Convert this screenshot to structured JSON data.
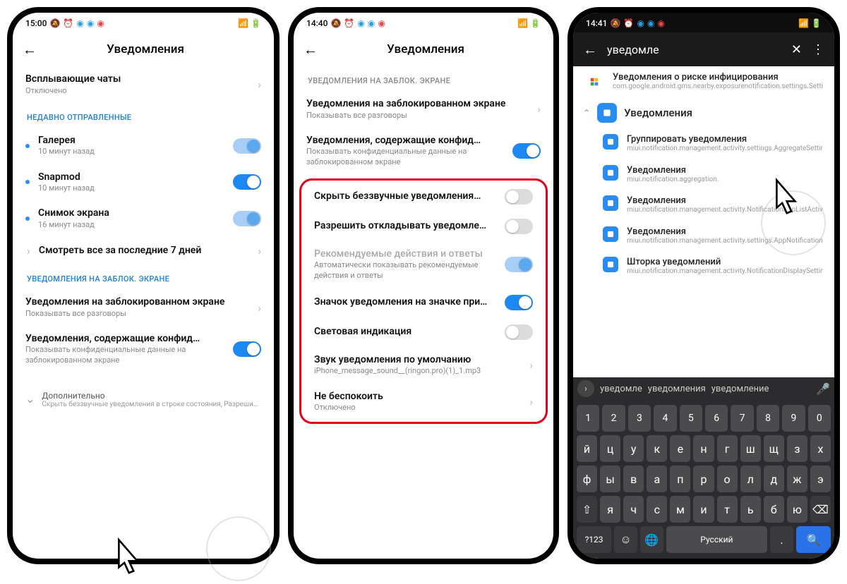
{
  "phone1": {
    "status": {
      "time": "15:00"
    },
    "title": "Уведомления",
    "popup": {
      "title": "Всплывающие чаты",
      "sub": "Отключено"
    },
    "recent_header": "НЕДАВНО ОТПРАВЛЕННЫЕ",
    "recent": [
      {
        "name": "Галерея",
        "sub": "10 минут назад",
        "toggle": "half"
      },
      {
        "name": "Snapmod",
        "sub": "10 минут назад",
        "toggle": "on"
      },
      {
        "name": "Снимок экрана",
        "sub": "16 минут назад",
        "toggle": "half"
      }
    ],
    "see_all": "Смотреть все за последние 7 дней",
    "lock_header": "УВЕДОМЛЕНИЯ НА ЗАБЛОК. ЭКРАНЕ",
    "lock1": {
      "title": "Уведомления на заблокированном экране",
      "sub": "Показывать все разговоры"
    },
    "lock2": {
      "title": "Уведомления, содержащие конфид…",
      "sub": "Показывать конфиденциальные данные на заблокированном экране"
    },
    "adv": {
      "title": "Дополнительно",
      "sub": "Скрыть беззвучные уведомления в строке состояния, Разрешить…"
    }
  },
  "phone2": {
    "status": {
      "time": "14:40"
    },
    "title": "Уведомления",
    "lock_header": "УВЕДОМЛЕНИЯ НА ЗАБЛОК. ЭКРАНЕ",
    "lock1": {
      "title": "Уведомления на заблокированном экране",
      "sub": "Показывать все разговоры"
    },
    "lock2": {
      "title": "Уведомления, содержащие конфид…",
      "sub": "Показывать конфиденциальные данные на заблокированном экране"
    },
    "items": [
      {
        "title": "Скрыть беззвучные уведомления…",
        "toggle": "off"
      },
      {
        "title": "Разрешить откладывать уведомле…",
        "toggle": "off"
      },
      {
        "title": "Рекомендуемые действия и ответы",
        "sub": "Автоматически показывать рекомендуемые действия и ответы",
        "toggle": "half",
        "disabled": true
      },
      {
        "title": "Значок уведомления на значке при…",
        "toggle": "on"
      },
      {
        "title": "Световая индикация",
        "toggle": "off"
      },
      {
        "title": "Звук уведомления по умолчанию",
        "sub": "iPhone_message_sound__(ringon.pro)(1)_1.mp3",
        "chev": true
      },
      {
        "title": "Не беспокоить",
        "sub": "Отключено",
        "chev": true
      }
    ]
  },
  "phone3": {
    "status": {
      "time": "14:41"
    },
    "search": "уведомле",
    "risk": {
      "title": "Уведомления о риске инфицирования",
      "sub": "com.google.android.gms.nearby.exposurenotification.settings.SettingsActivityAlias"
    },
    "parent": "Уведомления",
    "results": [
      {
        "title": "Группировать уведомления",
        "sub": "miui.notification.management.activity.settings.AggregateSettingActivity"
      },
      {
        "title": "Уведомления",
        "sub": "miui.notification.aggregation."
      },
      {
        "title": "Уведомления",
        "sub": "miui.notification.management.activity.NotificationAppListActivity"
      },
      {
        "title": "Уведомления",
        "sub": "miui.notification.management.activity.settings.AppNotificationRuleActivity"
      },
      {
        "title": "Шторка уведомлений",
        "sub": "miui.notification.management.activity.NotificationDisplaySettingsActivity"
      }
    ],
    "sugs": [
      "уведомле",
      "уведомления",
      "уведомление"
    ],
    "kbd": {
      "r1": [
        "1",
        "2",
        "3",
        "4",
        "5",
        "6",
        "7",
        "8",
        "9",
        "0"
      ],
      "r2": [
        "й",
        "ц",
        "у",
        "к",
        "е",
        "н",
        "г",
        "ш",
        "щ",
        "з",
        "х"
      ],
      "r3": [
        "ф",
        "ы",
        "в",
        "а",
        "п",
        "р",
        "о",
        "л",
        "д",
        "ж",
        "э"
      ],
      "r4": [
        "я",
        "ч",
        "с",
        "м",
        "и",
        "т",
        "ь",
        "б",
        "ю"
      ],
      "lang": "Русский",
      "q123": "?123"
    }
  }
}
